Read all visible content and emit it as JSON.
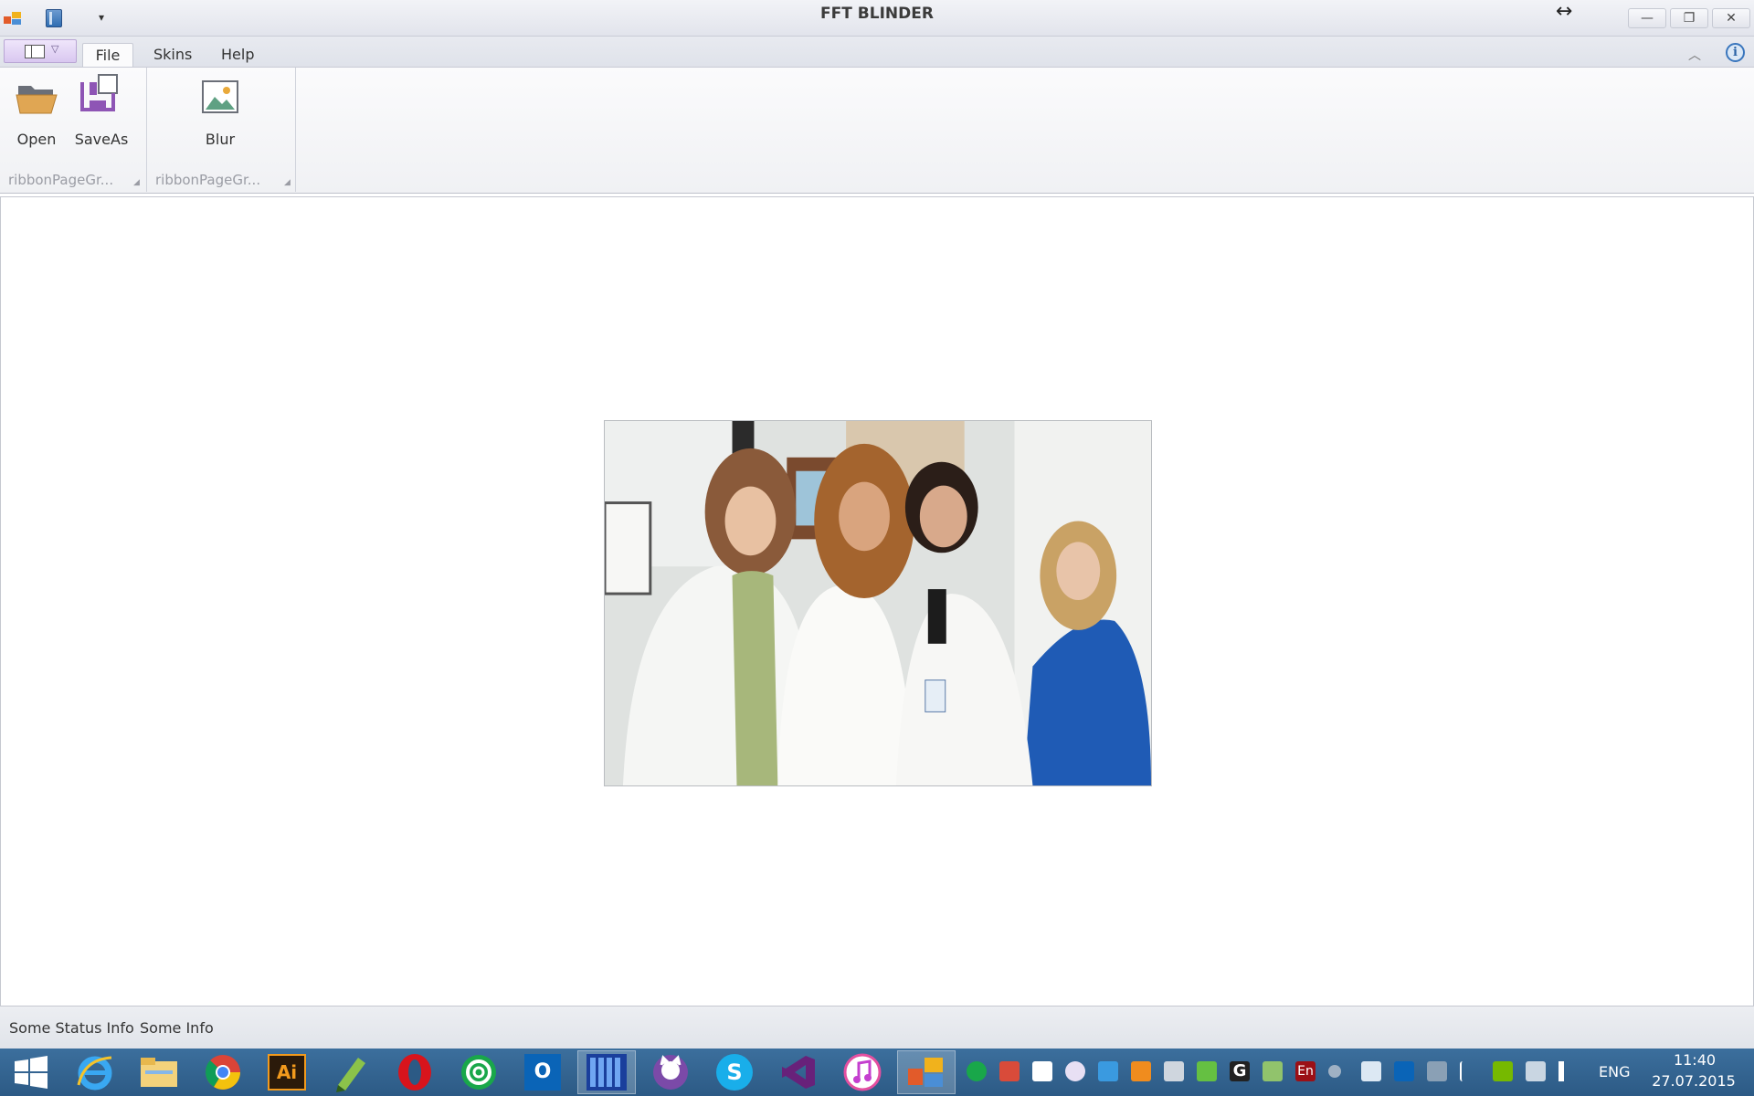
{
  "window": {
    "title": "FFT BLINDER",
    "resize_glyph": "↔",
    "controls": {
      "minimize": "—",
      "maximize": "❐",
      "close": "✕"
    },
    "qat_dropdown": "▾"
  },
  "tabs": {
    "file": "File",
    "skins": "Skins",
    "help": "Help"
  },
  "header_icons": {
    "collapse": "︿",
    "info": "i",
    "app_menu_arrow": "▽"
  },
  "ribbon": {
    "groups": [
      {
        "label": "ribbonPageGr...",
        "buttons": [
          {
            "label": "Open",
            "icon": "folder-open-icon"
          },
          {
            "label": "SaveAs",
            "icon": "save-as-icon"
          }
        ]
      },
      {
        "label": "ribbonPageGr...",
        "buttons": [
          {
            "label": "Blur",
            "icon": "image-icon"
          }
        ]
      }
    ]
  },
  "statusbar": {
    "item1": "Some Status Info",
    "item2": "Some Info"
  },
  "taskbar": {
    "apps": [
      "start-icon",
      "internet-explorer-icon",
      "file-explorer-icon",
      "chrome-icon",
      "illustrator-icon",
      "pen-app-icon",
      "opera-icon",
      "mail-agent-icon",
      "outlook-icon",
      "library-icon",
      "github-icon",
      "skype-icon",
      "visual-studio-icon",
      "itunes-icon",
      "fft-blinder-icon"
    ],
    "illustrator_label": "Ai",
    "outlook_label": "O",
    "skype_label": "S",
    "tray_en_label": "En",
    "tray_g_label": "G",
    "language": "ENG",
    "time": "11:40",
    "date": "27.07.2015"
  },
  "colors": {
    "accent": "#2c5a85",
    "ribbon_bg": "#f0f1f4",
    "app_menu": "#d9c7f0"
  }
}
